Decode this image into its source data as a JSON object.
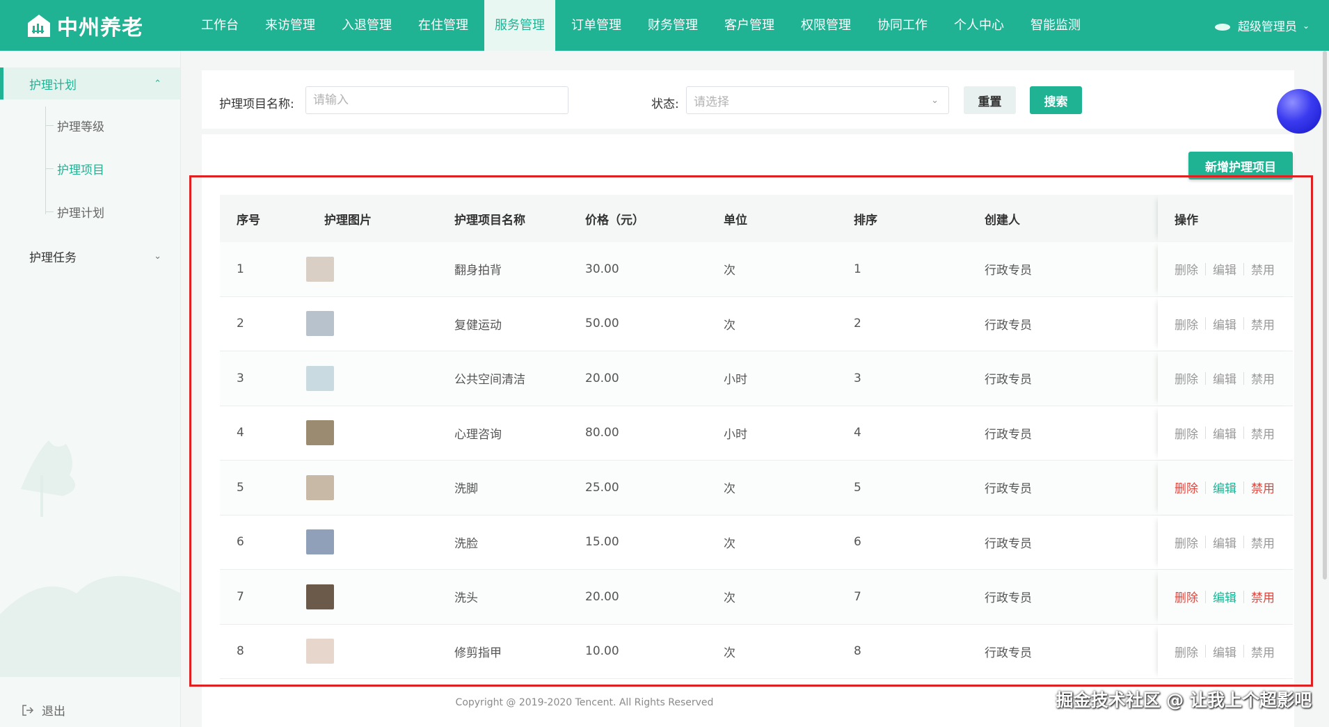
{
  "header": {
    "brand": "中州养老",
    "nav": [
      "工作台",
      "来访管理",
      "入退管理",
      "在住管理",
      "服务管理",
      "订单管理",
      "财务管理",
      "客户管理",
      "权限管理",
      "协同工作",
      "个人中心",
      "智能监测"
    ],
    "active_nav_index": 4,
    "user": "超级管理员"
  },
  "sidebar": {
    "groups": [
      {
        "label": "护理计划",
        "expanded": true,
        "items": [
          "护理等级",
          "护理项目",
          "护理计划"
        ],
        "active_item": 1
      },
      {
        "label": "护理任务",
        "expanded": false
      }
    ],
    "logout": "退出"
  },
  "filter": {
    "name_label": "护理项目名称:",
    "name_placeholder": "请输入",
    "status_label": "状态:",
    "status_placeholder": "请选择",
    "reset": "重置",
    "search": "搜索"
  },
  "actions": {
    "add": "新增护理项目"
  },
  "table": {
    "columns": [
      "序号",
      "护理图片",
      "护理项目名称",
      "价格（元）",
      "单位",
      "排序",
      "创建人",
      "操作"
    ],
    "op_labels": {
      "delete": "删除",
      "edit": "编辑",
      "disable": "禁用"
    },
    "rows": [
      {
        "no": "1",
        "name": "翻身拍背",
        "price": "30.00",
        "unit": "次",
        "sort": "1",
        "creator": "行政专员",
        "ops_active": false,
        "thumb_color": "#d9cfc4"
      },
      {
        "no": "2",
        "name": "复健运动",
        "price": "50.00",
        "unit": "次",
        "sort": "2",
        "creator": "行政专员",
        "ops_active": false,
        "thumb_color": "#b8c2cc"
      },
      {
        "no": "3",
        "name": "公共空间清洁",
        "price": "20.00",
        "unit": "小时",
        "sort": "3",
        "creator": "行政专员",
        "ops_active": false,
        "thumb_color": "#c9dbe0"
      },
      {
        "no": "4",
        "name": "心理咨询",
        "price": "80.00",
        "unit": "小时",
        "sort": "4",
        "creator": "行政专员",
        "ops_active": false,
        "thumb_color": "#9b8b70"
      },
      {
        "no": "5",
        "name": "洗脚",
        "price": "25.00",
        "unit": "次",
        "sort": "5",
        "creator": "行政专员",
        "ops_active": true,
        "thumb_color": "#c8b8a6"
      },
      {
        "no": "6",
        "name": "洗脸",
        "price": "15.00",
        "unit": "次",
        "sort": "6",
        "creator": "行政专员",
        "ops_active": false,
        "thumb_color": "#8fa0b8"
      },
      {
        "no": "7",
        "name": "洗头",
        "price": "20.00",
        "unit": "次",
        "sort": "7",
        "creator": "行政专员",
        "ops_active": true,
        "thumb_color": "#6b5a4a"
      },
      {
        "no": "8",
        "name": "修剪指甲",
        "price": "10.00",
        "unit": "次",
        "sort": "8",
        "creator": "行政专员",
        "ops_active": false,
        "thumb_color": "#e6d6cc"
      }
    ]
  },
  "footer": "Copyright @ 2019-2020 Tencent. All Rights Reserved",
  "watermark": "掘金技术社区 @ 让我上个超影吧",
  "colors": {
    "primary": "#1fb394",
    "danger": "#e0473f",
    "highlight_border": "#e02020"
  }
}
